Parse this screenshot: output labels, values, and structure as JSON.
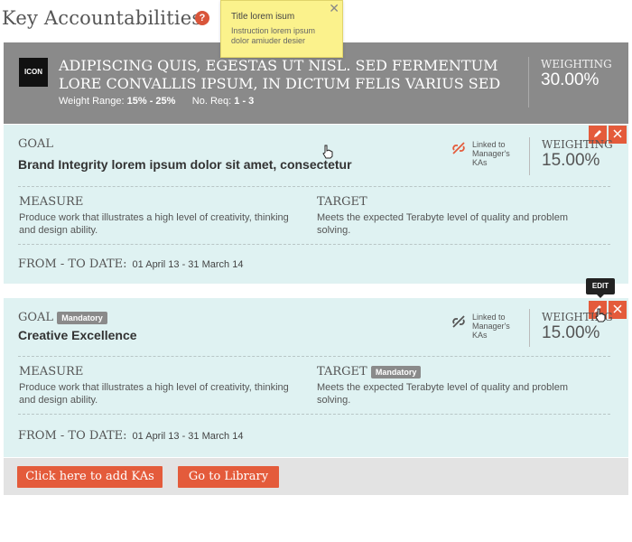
{
  "header": {
    "title": "Key Accountabilities",
    "help_icon": "?"
  },
  "tooltip": {
    "title": "Title lorem isum",
    "body": "Instruction lorem ipsum dolor amiuder desier",
    "close": "✕"
  },
  "category": {
    "icon_label": "ICON",
    "title": "ADIPISCING QUIS, EGESTAS UT NISL. SED FERMENTUM LORE CONVALLIS IPSUM, IN DICTUM FELIS VARIUS SED",
    "weight_range_label": "Weight Range:",
    "weight_range_value": "15% - 25%",
    "no_req_label": "No. Req:",
    "no_req_value": "1 - 3",
    "weighting_label": "WEIGHTING",
    "weighting_value": "30.00%"
  },
  "goals": [
    {
      "goal_label": "GOAL",
      "title": "Brand Integrity lorem ipsum dolor sit amet, consectetur",
      "linked_text": "Linked to Manager's KAs",
      "weighting_label": "WEIGHTING",
      "weighting_value": "15.00%",
      "measure_label": "MEASURE",
      "measure_text": "Produce work that illustrates a high level of creativity, thinking and design ability.",
      "target_label": "TARGET",
      "target_text": "Meets the expected Terabyte level of quality and problem solving.",
      "date_label": "FROM - TO DATE:",
      "date_value": "01 April 13 - 31 March 14"
    },
    {
      "goal_label": "GOAL",
      "goal_badge": "Mandatory",
      "title": "Creative Excellence",
      "linked_text": "Linked to Manager's KAs",
      "weighting_label": "WEIGHTING",
      "weighting_value": "15.00%",
      "measure_label": "MEASURE",
      "measure_text": "Produce work that illustrates a high level of creativity, thinking and design ability.",
      "target_label": "TARGET",
      "target_badge": "Mandatory",
      "target_text": "Meets the expected Terabyte level of quality and problem solving.",
      "date_label": "FROM - TO DATE:",
      "date_value": "01 April 13 - 31 March 14"
    }
  ],
  "edit_tooltip": "EDIT",
  "footer": {
    "add_button": "Click here to add KAs",
    "library_button": "Go to Library"
  },
  "colors": {
    "accent": "#e45b3b",
    "card_bg": "#dff2f2",
    "category_bg": "#8a8a8a",
    "tooltip_bg": "#fbf28c"
  },
  "icons": {
    "help": "question-icon",
    "edit": "pencil-icon",
    "delete": "close-icon",
    "link": "broken-link-icon"
  }
}
